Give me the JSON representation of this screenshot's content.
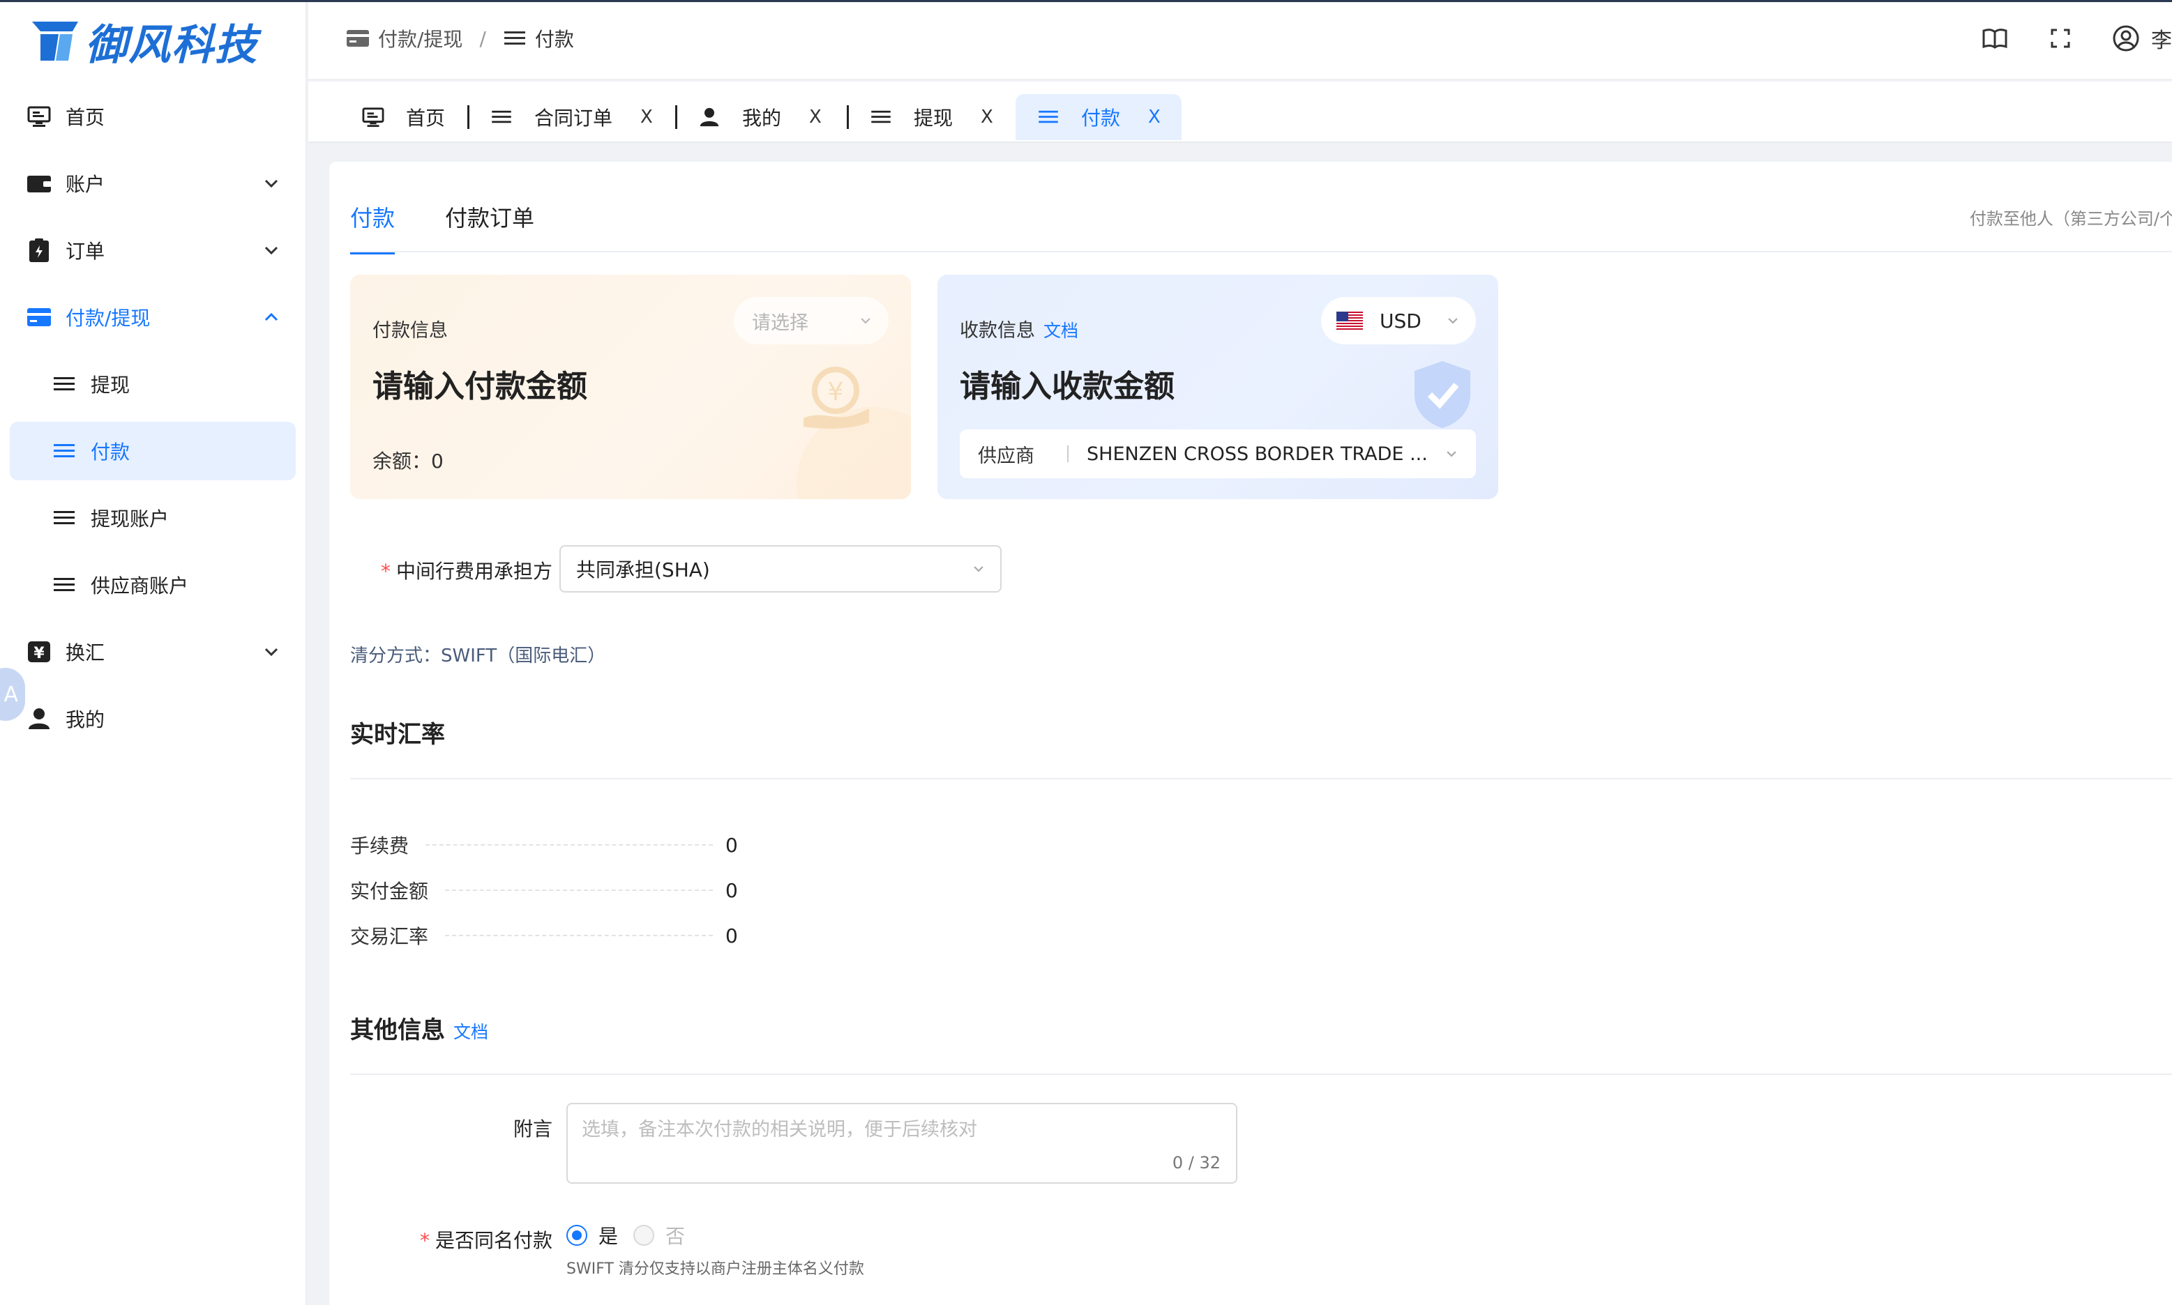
{
  "app": {
    "brand": "御风科技",
    "user_name": "李"
  },
  "sidebar": {
    "items": [
      {
        "label": "首页",
        "icon": "monitor-icon"
      },
      {
        "label": "账户",
        "icon": "wallet-icon"
      },
      {
        "label": "订单",
        "icon": "clipboard-icon"
      },
      {
        "label": "付款/提现",
        "icon": "card-icon"
      },
      {
        "label": "提现",
        "icon": "list-icon"
      },
      {
        "label": "付款",
        "icon": "list-icon"
      },
      {
        "label": "提现账户",
        "icon": "list-icon"
      },
      {
        "label": "供应商账户",
        "icon": "list-icon"
      },
      {
        "label": "换汇",
        "icon": "yen-icon"
      },
      {
        "label": "我的",
        "icon": "user-icon"
      }
    ],
    "float_label": "A"
  },
  "breadcrumb": {
    "parent": "付款/提现",
    "separator": "/",
    "current": "付款"
  },
  "tabs": [
    {
      "label": "首页"
    },
    {
      "label": "合同订单",
      "close": "X"
    },
    {
      "label": "我的",
      "close": "X"
    },
    {
      "label": "提现",
      "close": "X"
    },
    {
      "label": "付款",
      "close": "X"
    }
  ],
  "main": {
    "inner_tabs": [
      "付款",
      "付款订单"
    ],
    "right_note": "付款至他人（第三方公司/个",
    "pay_card": {
      "title": "付款信息",
      "select_placeholder": "请选择",
      "amount_placeholder": "请输入付款金额",
      "balance_label": "余额：",
      "balance_value": "0"
    },
    "recv_card": {
      "title": "收款信息",
      "doc_link": "文档",
      "currency": "USD",
      "amount_placeholder": "请输入收款金额",
      "supplier_label": "供应商",
      "supplier_value": "SHENZEN CROSS BORDER TRADE ..."
    },
    "fee_bearer": {
      "label": "中间行费用承担方",
      "value": "共同承担(SHA)"
    },
    "clearing": "清分方式：SWIFT（国际电汇）",
    "rate_section": {
      "title": "实时汇率",
      "rows": [
        {
          "k": "手续费",
          "v": "0"
        },
        {
          "k": "实付金额",
          "v": "0"
        },
        {
          "k": "交易汇率",
          "v": "0"
        }
      ]
    },
    "other_section": {
      "title": "其他信息",
      "doc_link": "文档"
    },
    "remark": {
      "label": "附言",
      "placeholder": "选填，备注本次付款的相关说明，便于后续核对",
      "counter": "0 / 32"
    },
    "same_name": {
      "label": "是否同名付款",
      "yes": "是",
      "no": "否",
      "hint": "SWIFT 清分仅支持以商户注册主体名义付款"
    }
  },
  "colors": {
    "accent": "#1677ff",
    "brand": "#1d6fd6",
    "required": "#ff4d4f"
  }
}
